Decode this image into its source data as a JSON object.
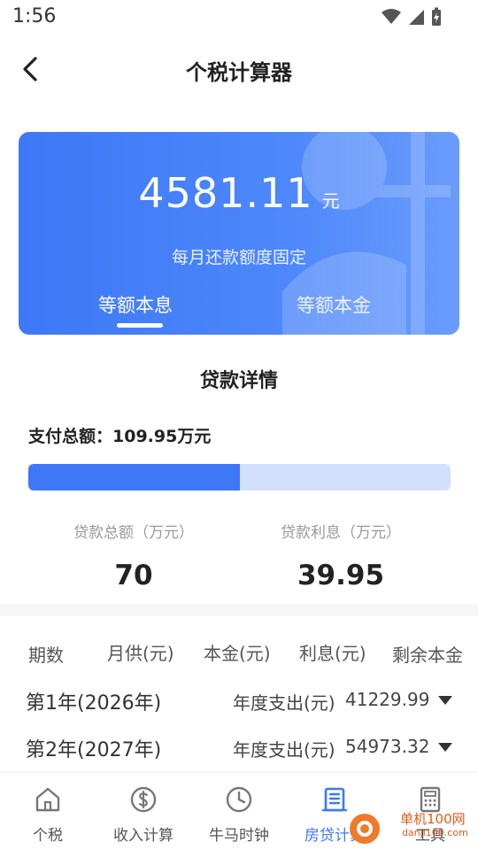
{
  "status_bar": {
    "time": "1:56"
  },
  "nav": {
    "title": "个税计算器"
  },
  "hero": {
    "amount": "4581.11",
    "unit": "元",
    "subtitle": "每月还款额度固定",
    "tabs": [
      {
        "label": "等额本息",
        "active": true
      },
      {
        "label": "等额本金",
        "active": false
      }
    ]
  },
  "details": {
    "title": "贷款详情",
    "total_label": "支付总额：109.95万元",
    "principal_ratio": 0.5,
    "stats": [
      {
        "label": "贷款总额（万元）",
        "value": "70"
      },
      {
        "label": "贷款利息（万元）",
        "value": "39.95"
      }
    ]
  },
  "table": {
    "headers": [
      "期数",
      "月供(元)",
      "本金(元)",
      "利息(元)",
      "剩余本金"
    ],
    "rows": [
      {
        "year": "第1年(2026年)",
        "expense_label": "年度支出(元)",
        "expense_value": "41229.99"
      },
      {
        "year": "第2年(2027年)",
        "expense_label": "年度支出(元)",
        "expense_value": "54973.32"
      }
    ]
  },
  "tabbar": {
    "items": [
      {
        "label": "个税",
        "icon": "home-icon",
        "active": false
      },
      {
        "label": "收入计算",
        "icon": "dollar-icon",
        "active": false
      },
      {
        "label": "牛马时钟",
        "icon": "clock-icon",
        "active": false
      },
      {
        "label": "房贷计算",
        "icon": "building-icon",
        "active": true
      },
      {
        "label": "工具",
        "icon": "calculator-icon",
        "active": false
      }
    ]
  },
  "watermark": {
    "cn": "单机100网",
    "en": "danji100.com"
  },
  "colors": {
    "accent": "#3f78f6",
    "progress_track": "#d3e0fd"
  }
}
